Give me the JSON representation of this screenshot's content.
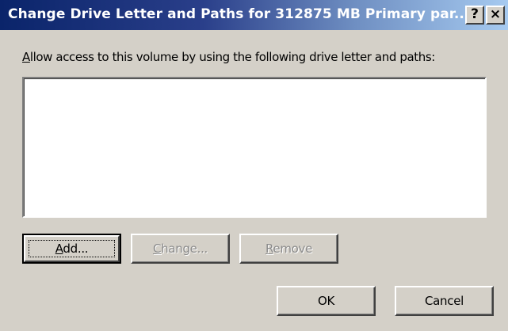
{
  "window": {
    "title": "Change Drive Letter and Paths for 312875 MB  Primary par...",
    "help_label": "?",
    "close_label": "×"
  },
  "dialog": {
    "description_first_letter": "A",
    "description_rest": "llow access to this volume by using the following drive letter and paths:",
    "paths_list": []
  },
  "buttons": {
    "add_first": "A",
    "add_rest": "dd...",
    "change_first": "C",
    "change_rest": "hange...",
    "remove_first": "R",
    "remove_rest": "emove",
    "ok": "OK",
    "cancel": "Cancel"
  }
}
